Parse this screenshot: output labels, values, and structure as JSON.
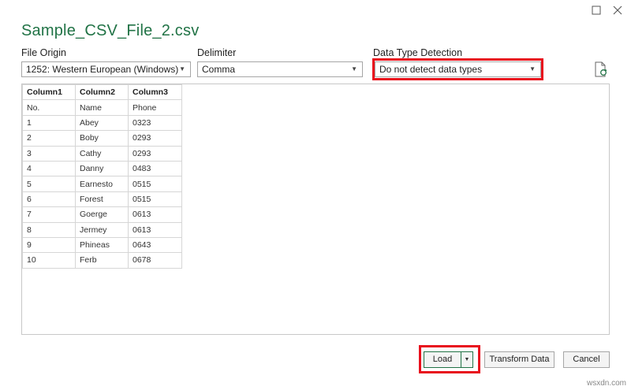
{
  "window": {
    "title": "Sample_CSV_File_2.csv"
  },
  "file_origin": {
    "label": "File Origin",
    "value": "1252: Western European (Windows)"
  },
  "delimiter": {
    "label": "Delimiter",
    "value": "Comma"
  },
  "data_type_detection": {
    "label": "Data Type Detection",
    "value": "Do not detect data types"
  },
  "table": {
    "headers": [
      "Column1",
      "Column2",
      "Column3"
    ],
    "rows": [
      [
        "No.",
        "Name",
        "Phone"
      ],
      [
        "1",
        "Abey",
        "0323"
      ],
      [
        "2",
        "Boby",
        "0293"
      ],
      [
        "3",
        "Cathy",
        "0293"
      ],
      [
        "4",
        "Danny",
        "0483"
      ],
      [
        "5",
        "Earnesto",
        "0515"
      ],
      [
        "6",
        "Forest",
        "0515"
      ],
      [
        "7",
        "Goerge",
        "0613"
      ],
      [
        "8",
        "Jermey",
        "0613"
      ],
      [
        "9",
        "Phineas",
        "0643"
      ],
      [
        "10",
        "Ferb",
        "0678"
      ]
    ]
  },
  "buttons": {
    "load": "Load",
    "transform": "Transform Data",
    "cancel": "Cancel"
  },
  "watermark": "wsxdn.com",
  "colors": {
    "title": "#217346",
    "highlight": "#e8101d"
  },
  "icons": {
    "maximize": "maximize-icon",
    "close": "close-icon",
    "refresh": "refresh-file-icon",
    "dropdown": "chevron-down-icon"
  }
}
